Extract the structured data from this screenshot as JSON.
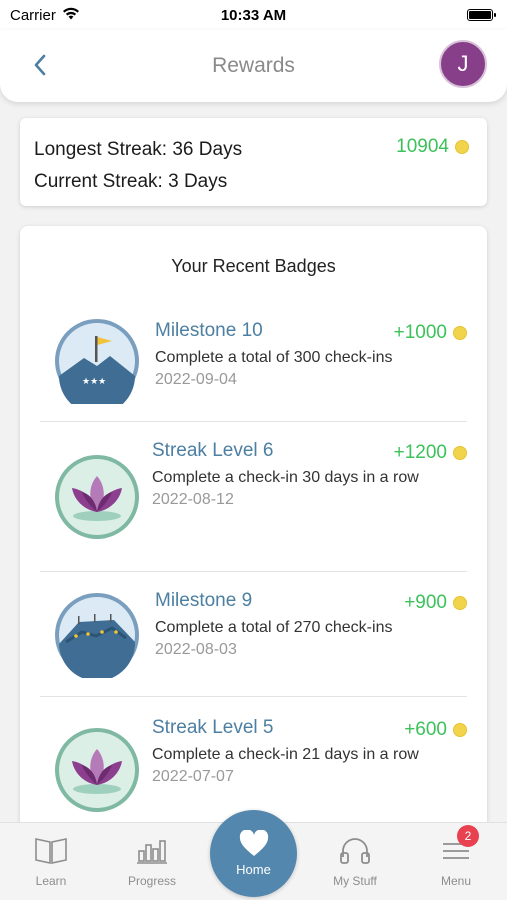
{
  "status_bar": {
    "carrier": "Carrier",
    "time": "10:33 AM"
  },
  "header": {
    "title": "Rewards",
    "avatar_initial": "J"
  },
  "streaks": {
    "longest": "Longest Streak: 36 Days",
    "current": "Current Streak: 3 Days",
    "points": "10904"
  },
  "badges": {
    "title": "Your Recent Badges",
    "items": [
      {
        "name": "Milestone 10",
        "points": "+1000",
        "desc": "Complete a total of 300 check-ins",
        "date": "2022-09-04",
        "icon": "milestone-flag-icon"
      },
      {
        "name": "Streak Level 6",
        "points": "+1200",
        "desc": "Complete a check-in 30 days in a row",
        "date": "2022-08-12",
        "icon": "lotus-icon"
      },
      {
        "name": "Milestone 9",
        "points": "+900",
        "desc": "Complete a total of 270 check-ins",
        "date": "2022-08-03",
        "icon": "mountain-path-icon"
      },
      {
        "name": "Streak Level 5",
        "points": "+600",
        "desc": "Complete a check-in 21 days in a row",
        "date": "2022-07-07",
        "icon": "lotus-icon"
      }
    ]
  },
  "tabs": {
    "learn": "Learn",
    "progress": "Progress",
    "home": "Home",
    "my_stuff": "My Stuff",
    "menu": "Menu",
    "menu_badge": "2"
  },
  "colors": {
    "accent": "#5387ad",
    "points_green": "#3cc25a",
    "badge_title_blue": "#4c7fa1",
    "avatar_purple": "#873f8a",
    "coin_yellow": "#f2d44c",
    "notification_red": "#e8414f"
  }
}
